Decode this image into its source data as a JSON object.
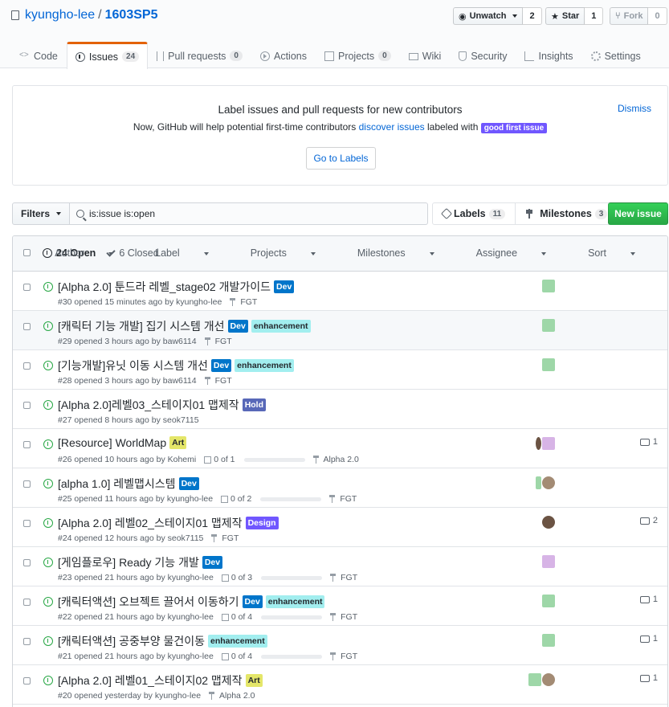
{
  "repo": {
    "owner": "kyungho-lee",
    "separator": "/",
    "name": "1603SP5"
  },
  "actions": {
    "watch_label": "Unwatch",
    "watch_count": "2",
    "star_label": "Star",
    "star_count": "1",
    "fork_label": "Fork",
    "fork_count": "0"
  },
  "tabs": [
    {
      "label": "Code",
      "icon": "code-icon"
    },
    {
      "label": "Issues",
      "count": "24",
      "icon": "issue-opened-icon"
    },
    {
      "label": "Pull requests",
      "count": "0",
      "icon": "git-pull-request-icon"
    },
    {
      "label": "Actions",
      "icon": "play-icon"
    },
    {
      "label": "Projects",
      "count": "0",
      "icon": "project-icon"
    },
    {
      "label": "Wiki",
      "icon": "book-icon"
    },
    {
      "label": "Security",
      "icon": "shield-icon"
    },
    {
      "label": "Insights",
      "icon": "graph-icon"
    },
    {
      "label": "Settings",
      "icon": "gear-icon"
    }
  ],
  "banner": {
    "title": "Label issues and pull requests for new contributors",
    "desc_before": "Now, GitHub will help potential first-time contributors ",
    "desc_link": "discover issues",
    "desc_after": " labeled with ",
    "label": "good first issue",
    "button": "Go to Labels",
    "dismiss": "Dismiss"
  },
  "filters": {
    "button": "Filters",
    "query": "is:issue is:open",
    "labels_label": "Labels",
    "labels_count": "11",
    "milestones_label": "Milestones",
    "milestones_count": "3",
    "new_issue": "New issue"
  },
  "list_header": {
    "open": "24 Open",
    "closed": "6 Closed",
    "sorts": [
      "Author",
      "Label",
      "Projects",
      "Milestones",
      "Assignee",
      "Sort"
    ]
  },
  "colors": {
    "Dev": "#0075ca",
    "enhancement": "#a2eeef",
    "Hold": "#5868b8",
    "Art": "#e4e669",
    "Design": "#7057ff",
    "good_first_issue": "#7057ff",
    "open_green": "#28a745",
    "new_issue_green": "#2cbe4e"
  },
  "issues": [
    {
      "title": "[Alpha 2.0] 툰드라 레벨_stage02 개발가이드",
      "labels": [
        {
          "name": "Dev",
          "fg": "#fff",
          "bg": "#0075ca"
        }
      ],
      "meta": "#30 opened 15 minutes ago by kyungho-lee",
      "tasks": "",
      "milestone": "FGT",
      "comments": ""
    },
    {
      "title": "[캐릭터 기능 개발] 집기 시스템 개선",
      "labels": [
        {
          "name": "Dev",
          "fg": "#fff",
          "bg": "#0075ca"
        },
        {
          "name": "enhancement",
          "fg": "#24292e",
          "bg": "#a2eeef"
        }
      ],
      "meta": "#29 opened 3 hours ago by baw6114",
      "tasks": "",
      "milestone": "FGT",
      "comments": ""
    },
    {
      "title": "[기능개발]유닛 이동 시스템 개선",
      "labels": [
        {
          "name": "Dev",
          "fg": "#fff",
          "bg": "#0075ca"
        },
        {
          "name": "enhancement",
          "fg": "#24292e",
          "bg": "#a2eeef"
        }
      ],
      "meta": "#28 opened 3 hours ago by baw6114",
      "tasks": "",
      "milestone": "FGT",
      "comments": ""
    },
    {
      "title": "[Alpha 2.0]레벨03_스테이지01 맵제작",
      "labels": [
        {
          "name": "Hold",
          "fg": "#fff",
          "bg": "#5868b8"
        }
      ],
      "meta": "#27 opened 8 hours ago by seok7115",
      "tasks": "",
      "milestone": "",
      "comments": ""
    },
    {
      "title": "[Resource] WorldMap",
      "labels": [
        {
          "name": "Art",
          "fg": "#24292e",
          "bg": "#e4e669"
        }
      ],
      "meta": "#26 opened 10 hours ago by Kohemi",
      "tasks": "0 of 1",
      "milestone": "Alpha 2.0",
      "comments": "1"
    },
    {
      "title": "[alpha 1.0] 레벨맵시스템",
      "labels": [
        {
          "name": "Dev",
          "fg": "#fff",
          "bg": "#0075ca"
        }
      ],
      "meta": "#25 opened 11 hours ago by kyungho-lee",
      "tasks": "0 of 2",
      "milestone": "FGT",
      "comments": ""
    },
    {
      "title": "[Alpha 2.0] 레벨02_스테이지01 맵제작",
      "labels": [
        {
          "name": "Design",
          "fg": "#fff",
          "bg": "#7057ff"
        }
      ],
      "meta": "#24 opened 12 hours ago by seok7115",
      "tasks": "",
      "milestone": "FGT",
      "comments": "2"
    },
    {
      "title": "[게임플로우] Ready 기능 개발",
      "labels": [
        {
          "name": "Dev",
          "fg": "#fff",
          "bg": "#0075ca"
        }
      ],
      "meta": "#23 opened 21 hours ago by kyungho-lee",
      "tasks": "0 of 3",
      "milestone": "FGT",
      "comments": ""
    },
    {
      "title": "[캐릭터액션] 오브젝트 끌어서 이동하기",
      "labels": [
        {
          "name": "Dev",
          "fg": "#fff",
          "bg": "#0075ca"
        },
        {
          "name": "enhancement",
          "fg": "#24292e",
          "bg": "#a2eeef"
        }
      ],
      "meta": "#22 opened 21 hours ago by kyungho-lee",
      "tasks": "0 of 4",
      "milestone": "FGT",
      "comments": "1"
    },
    {
      "title": "[캐릭터액션] 공중부양 물건이동",
      "labels": [
        {
          "name": "enhancement",
          "fg": "#24292e",
          "bg": "#a2eeef"
        }
      ],
      "meta": "#21 opened 21 hours ago by kyungho-lee",
      "tasks": "0 of 4",
      "milestone": "FGT",
      "comments": "1"
    },
    {
      "title": "[Alpha 2.0] 레벨01_스테이지02 맵제작",
      "labels": [
        {
          "name": "Art",
          "fg": "#24292e",
          "bg": "#e4e669"
        }
      ],
      "meta": "#20 opened yesterday by kyungho-lee",
      "tasks": "",
      "milestone": "Alpha 2.0",
      "comments": "1"
    }
  ]
}
